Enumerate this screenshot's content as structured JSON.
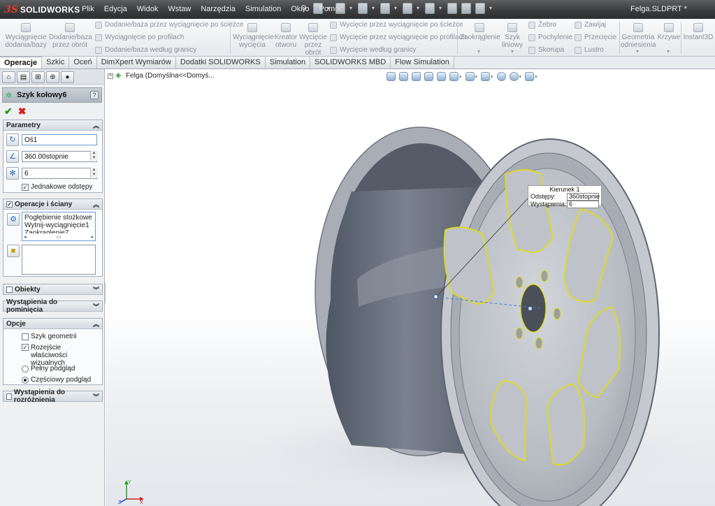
{
  "app": {
    "logo_prefix": "3S",
    "logo_name": "SOLIDWORKS",
    "document_title": "Felga.SLDPRT *"
  },
  "menu": [
    "Plik",
    "Edycja",
    "Widok",
    "Wstaw",
    "Narzędzia",
    "Simulation",
    "Okno",
    "Pomoc"
  ],
  "commands": {
    "extrude_boss": "Wyciągnięcie dodania/bazy",
    "revolve_boss": "Dodanie/baza przez obrót",
    "swept_boss": "Dodanie/baza przez wyciągnięcie po ścieżce",
    "lofted_boss": "Wyciągnięcie po profilach",
    "boundary_boss": "Dodanie/baza według granicy",
    "extrude_cut": "Wyciągnięcie wycięcia",
    "hole_wizard": "Kreator otworu",
    "revolve_cut": "Wycięcie przez obrót",
    "swept_cut": "Wycięcie przez wyciągnięcie po ścieżce",
    "lofted_cut": "Wycięcie przez wyciągnięcie po profilach",
    "boundary_cut": "Wycięcie według granicy",
    "fillet": "Zaokrąglenie",
    "linear_pattern": "Szyk liniowy",
    "rib": "Żebro",
    "draft": "Pochylenie",
    "shell": "Skorupa",
    "wrap": "Zawijaj",
    "intersect": "Przecięcie",
    "mirror": "Lustro",
    "reference_geometry": "Geometria odniesienia",
    "curves": "Krzywe",
    "instant3d": "Instant3D"
  },
  "tabs": [
    {
      "label": "Operacje",
      "active": true
    },
    {
      "label": "Szkic",
      "active": false
    },
    {
      "label": "Oceń",
      "active": false
    },
    {
      "label": "DimXpert Wymiarów",
      "active": false
    },
    {
      "label": "Dodatki SOLIDWORKS",
      "active": false
    },
    {
      "label": "Simulation",
      "active": false
    },
    {
      "label": "SOLIDWORKS MBD",
      "active": false
    },
    {
      "label": "Flow Simulation",
      "active": false
    }
  ],
  "property_manager": {
    "title": "Szyk kołowy6",
    "help": "?",
    "parameters": {
      "header": "Parametry",
      "axis": "Oś1",
      "angle": "360.00stopnie",
      "instances": "6",
      "equal_spacing_label": "Jednakowe odstępy",
      "equal_spacing_checked": true
    },
    "features_faces": {
      "header": "Operacje i ściany",
      "checked": true,
      "items": [
        "Pogłębienie stożkowe",
        "Wytnij-wyciągnięcie1",
        "Zaokrąglenie7"
      ]
    },
    "bodies": {
      "header": "Obiekty",
      "checked": false
    },
    "instances_to_skip": {
      "header": "Wystąpienia do pominięcia"
    },
    "options": {
      "header": "Opcje",
      "geometry_pattern_label": "Szyk geometrii",
      "geometry_pattern_checked": false,
      "propagate_visual_label": "Rozejście właściwości wizualnych",
      "propagate_visual_checked": true,
      "full_preview_label": "Pełny podgląd",
      "partial_preview_label": "Częściowy podgląd",
      "preview_mode": "partial"
    },
    "instances_to_vary": {
      "header": "Wystąpienia do rozróżnienia",
      "checked": false
    }
  },
  "graphics": {
    "tree_root": "Felga  (Domyślna<<Domyś...",
    "callout": {
      "title": "Kierunek 1",
      "spacing_label": "Odstępy:",
      "spacing_value": "360stopnie",
      "instances_label": "Wystąpienia:",
      "instances_value": "6"
    },
    "triad": {
      "x": "X",
      "y": "Y",
      "z": "Z"
    }
  },
  "colors": {
    "accent": "#2a6db8",
    "highlight": "#e8e400",
    "ok": "#1a9b1a",
    "cancel": "#d21c1c"
  }
}
